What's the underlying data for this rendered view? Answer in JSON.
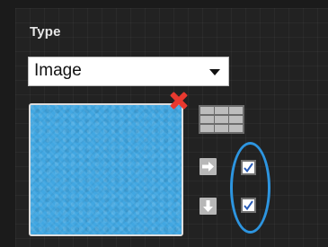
{
  "type_section": {
    "label": "Type",
    "select_value": "Image"
  },
  "image": {
    "fill_color": "#41a7e2",
    "remove_icon": "red-x-icon"
  },
  "repeat": {
    "grid_icon": "tile-grid-icon",
    "horizontal_icon": "arrow-right-icon",
    "vertical_icon": "arrow-down-icon",
    "repeat_x_checked": true,
    "repeat_y_checked": true
  },
  "colors": {
    "accent_ring": "#2d95e0",
    "remove": "#e8392f"
  }
}
